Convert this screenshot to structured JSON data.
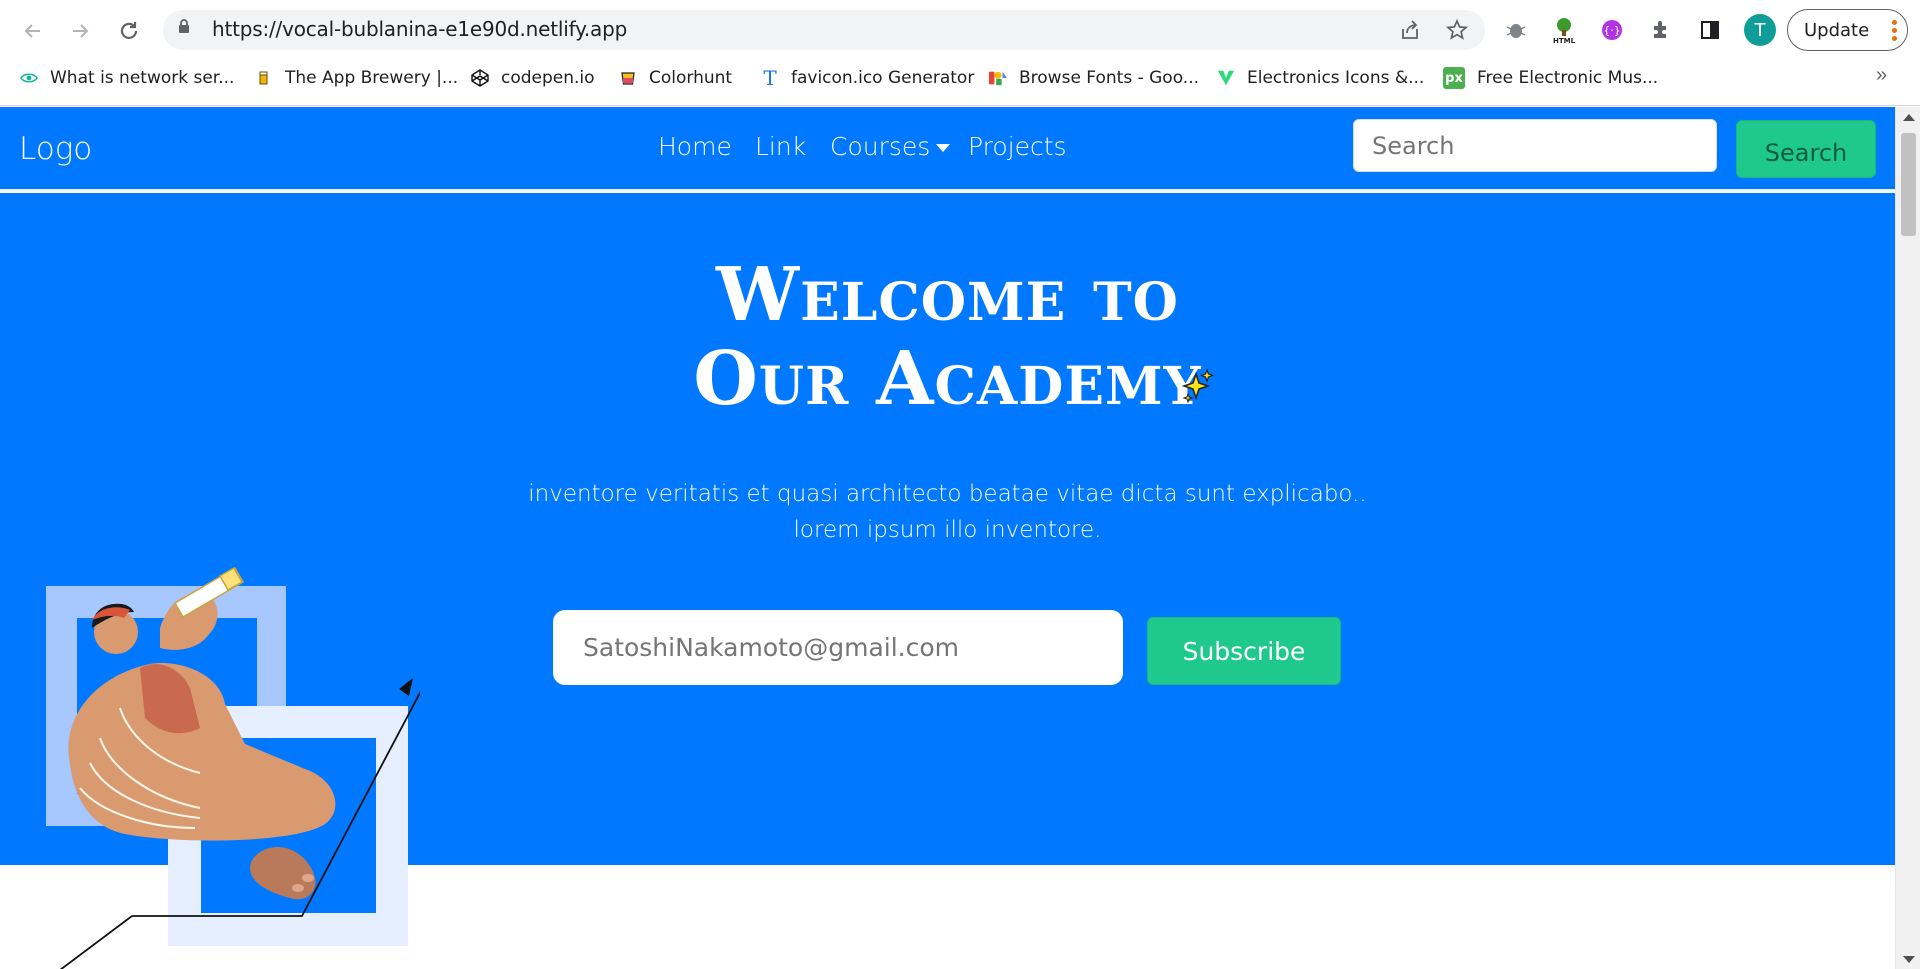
{
  "browser": {
    "url": "https://vocal-bublanina-e1e90d.netlify.app",
    "update_label": "Update",
    "profile_initial": "T",
    "bookmarks": [
      {
        "label": "What is network ser...",
        "icon": "eye-icon"
      },
      {
        "label": "The App Brewery |...",
        "icon": "beer-icon"
      },
      {
        "label": "codepen.io",
        "icon": "codepen-icon"
      },
      {
        "label": "Colorhunt",
        "icon": "colorhunt-icon"
      },
      {
        "label": "favicon.ico Generator",
        "icon": "favicon-generator-icon"
      },
      {
        "label": "Browse Fonts - Goo...",
        "icon": "google-fonts-icon"
      },
      {
        "label": "Electronics Icons &...",
        "icon": "electronics-icons-icon"
      },
      {
        "label": "Free Electronic Mus...",
        "icon": "px-icon"
      }
    ],
    "bookmarks_more": "»"
  },
  "navbar": {
    "logo": "Logo",
    "links": [
      "Home",
      "Link",
      "Courses",
      "Projects"
    ],
    "search_placeholder": "Search",
    "search_button": "Search"
  },
  "hero": {
    "title_line1": "Welcome to",
    "title_line2": "Our Academy",
    "text_line1": "inventore veritatis et quasi architecto beatae vitae dicta sunt explicabo..",
    "text_line2": "lorem ipsum illo inventore.",
    "email_placeholder": "SatoshiNakamoto@gmail.com",
    "subscribe_label": "Subscribe"
  },
  "colors": {
    "primary": "#0078ff",
    "accent": "#1fc98d"
  }
}
